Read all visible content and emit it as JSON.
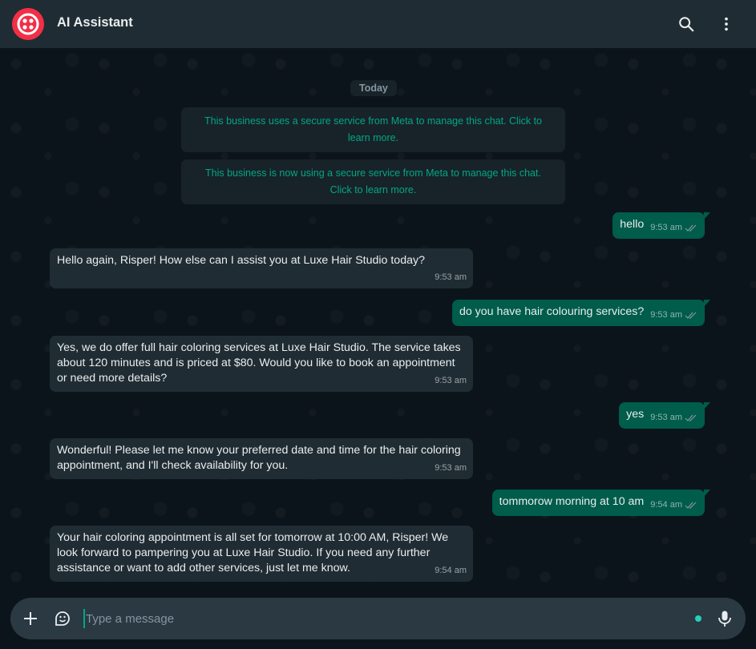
{
  "header": {
    "title": "AI Assistant",
    "avatar_icon": "twilio-logo-icon",
    "avatar_color": "#f22f46",
    "search_icon": "search-icon",
    "menu_icon": "more-vertical-icon"
  },
  "chat": {
    "date_label": "Today",
    "system_messages": [
      "This business uses a secure service from Meta to manage this chat. Click to learn more.",
      "This business is now using a secure service from Meta to manage this chat. Click to learn more."
    ],
    "messages": [
      {
        "direction": "out",
        "text": "hello",
        "time": "9:53 am",
        "status": "read"
      },
      {
        "direction": "in",
        "text": "Hello again, Risper! How else can I assist you at Luxe Hair Studio today?",
        "time": "9:53 am"
      },
      {
        "direction": "out",
        "text": "do you have hair colouring services?",
        "time": "9:53 am",
        "status": "read"
      },
      {
        "direction": "in",
        "text": "Yes, we do offer full hair coloring services at Luxe Hair Studio. The service takes about 120 minutes and is priced at $80. Would you like to book an appointment or need more details?",
        "time": "9:53 am"
      },
      {
        "direction": "out",
        "text": "yes",
        "time": "9:53 am",
        "status": "read"
      },
      {
        "direction": "in",
        "text": "Wonderful! Please let me know your preferred date and time for the hair coloring appointment, and I'll check availability for you.",
        "time": "9:53 am"
      },
      {
        "direction": "out",
        "text": "tommorow morning at 10 am",
        "time": "9:54 am",
        "status": "read"
      },
      {
        "direction": "in",
        "text": "Your hair coloring appointment is all set for tomorrow at 10:00 AM, Risper! We look forward to pampering you at Luxe Hair Studio. If you need any further assistance or want to add other services, just let me know.",
        "time": "9:54 am"
      }
    ]
  },
  "composer": {
    "placeholder": "Type a message",
    "value": "",
    "attach_icon": "plus-icon",
    "sticker_icon": "sticker-icon",
    "mic_icon": "microphone-icon"
  },
  "colors": {
    "accent": "#00a884",
    "incoming_bubble": "#202c33",
    "outgoing_bubble": "#005c4b",
    "background": "#0b141a"
  }
}
